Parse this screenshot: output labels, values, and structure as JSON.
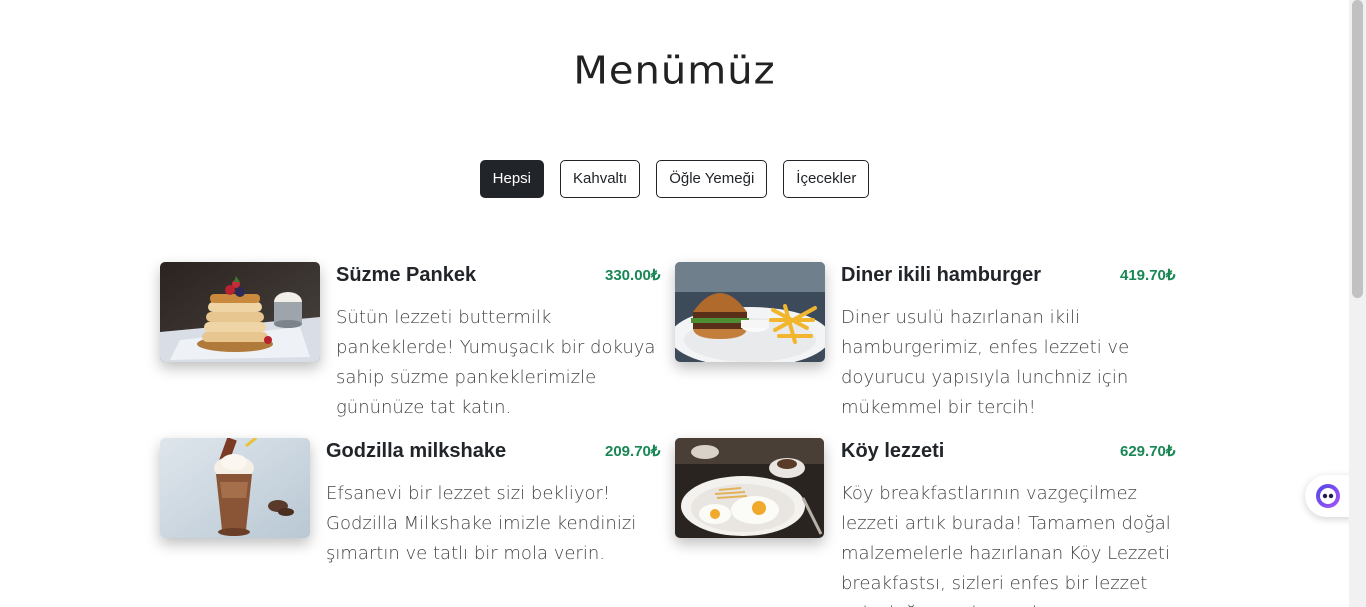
{
  "page": {
    "title": "Menümüz"
  },
  "filters": [
    {
      "label": "Hepsi",
      "active": true
    },
    {
      "label": "Kahvaltı",
      "active": false
    },
    {
      "label": "Öğle Yemeği",
      "active": false
    },
    {
      "label": "İçecekler",
      "active": false
    }
  ],
  "menu_items": [
    {
      "name": "Süzme Pankek",
      "price": "330.00₺",
      "description": "Sütün lezzeti buttermilk pankeklerde! Yumuşacık bir dokuya sahip süzme pankeklerimizle gününüze tat katın.",
      "image": "pancake-stack-photo"
    },
    {
      "name": "Diner ikili hamburger",
      "price": "419.70₺",
      "description": "Diner usulü hazırlanan ikili hamburgerimiz, enfes lezzeti ve doyurucu yapısıyla lunchniz için mükemmel bir tercih!",
      "image": "burger-and-fries-photo"
    },
    {
      "name": "Godzilla milkshake",
      "price": "209.70₺",
      "description": "Efsanevi bir lezzet sizi bekliyor! Godzilla Milkshake imizle kendinizi şımartın ve tatlı bir mola verin.",
      "image": "milkshake-photo"
    },
    {
      "name": "Köy lezzeti",
      "price": "629.70₺",
      "description": "Köy breakfastlarının vazgeçilmez lezzeti artık burada! Tamamen doğal malzemelerle hazırlanan Köy Lezzeti breakfastsı, sizleri enfes bir lezzet yolculuğuna çıkaracak.",
      "image": "village-breakfast-photo"
    }
  ],
  "widget": {
    "icon": "chat-assistant-icon"
  }
}
